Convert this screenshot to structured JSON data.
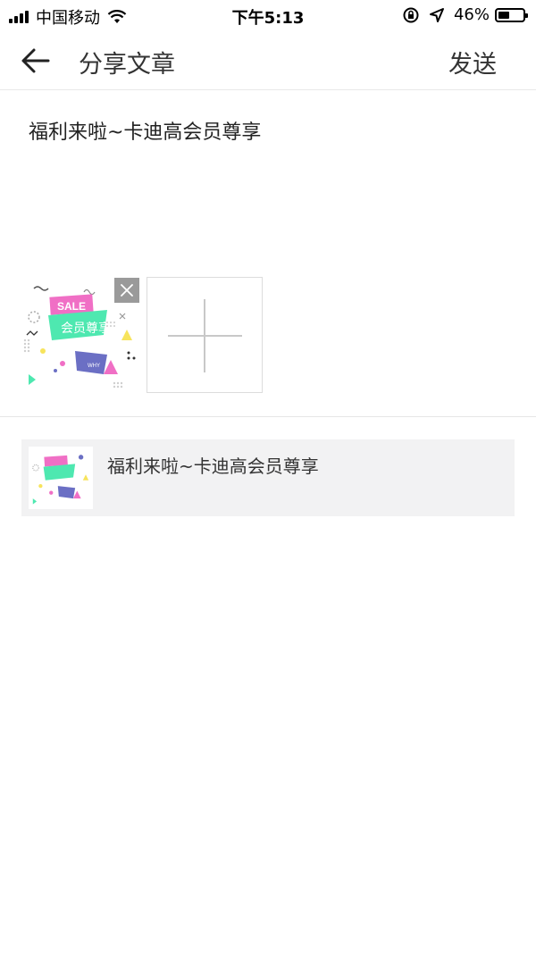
{
  "status_bar": {
    "carrier": "中国移动",
    "time": "下午5:13",
    "battery_percent": "46%",
    "battery_level": 0.46,
    "icons": [
      "signal-icon",
      "wifi-icon",
      "rotation-lock-icon",
      "location-icon",
      "battery-icon"
    ]
  },
  "nav": {
    "back_icon": "back-arrow-icon",
    "title": "分享文章",
    "send_label": "发送"
  },
  "article": {
    "title": "福利来啦~卡迪高会员尊享"
  },
  "images": {
    "thumb_text": "SALE",
    "thumb_banner": "会员尊享",
    "thumb_small": "WHY",
    "remove_icon": "close-icon",
    "add_icon": "plus-icon"
  },
  "link_card": {
    "title": "福利来啦~卡迪高会员尊享"
  },
  "colors": {
    "pink": "#f06fc5",
    "mint": "#4ee8b0",
    "indigo": "#6b6fc4",
    "yellow": "#f7e45c",
    "card_bg": "#f2f2f3"
  }
}
